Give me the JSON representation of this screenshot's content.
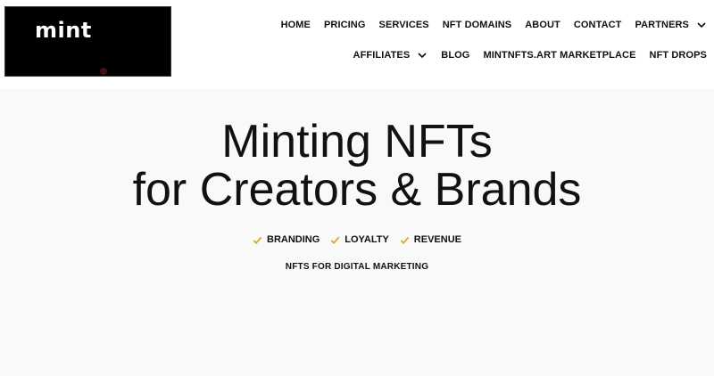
{
  "logo": {
    "text": "mint"
  },
  "nav": {
    "row1": [
      {
        "label": "HOME"
      },
      {
        "label": "PRICING"
      },
      {
        "label": "SERVICES"
      },
      {
        "label": "NFT DOMAINS"
      },
      {
        "label": "ABOUT"
      },
      {
        "label": "CONTACT"
      },
      {
        "label": "PARTNERS"
      }
    ],
    "row2": [
      {
        "label": "AFFILIATES"
      },
      {
        "label": "BLOG"
      },
      {
        "label": "MINTNFTS.ART MARKETPLACE"
      },
      {
        "label": "NFT DROPS"
      }
    ]
  },
  "hero": {
    "title_line1": "Minting NFTs",
    "title_line2": "for Creators & Brands",
    "features": [
      {
        "label": "BRANDING"
      },
      {
        "label": "LOYALTY"
      },
      {
        "label": "REVENUE"
      }
    ],
    "tagline": "NFTS FOR DIGITAL MARKETING"
  },
  "colors": {
    "accent_check": "#e0a62a",
    "hero_bg": "#f9f9f9",
    "logo_bg": "#000000"
  },
  "icons": {
    "dropdown": "chevron-down-icon",
    "feature": "check-icon"
  }
}
